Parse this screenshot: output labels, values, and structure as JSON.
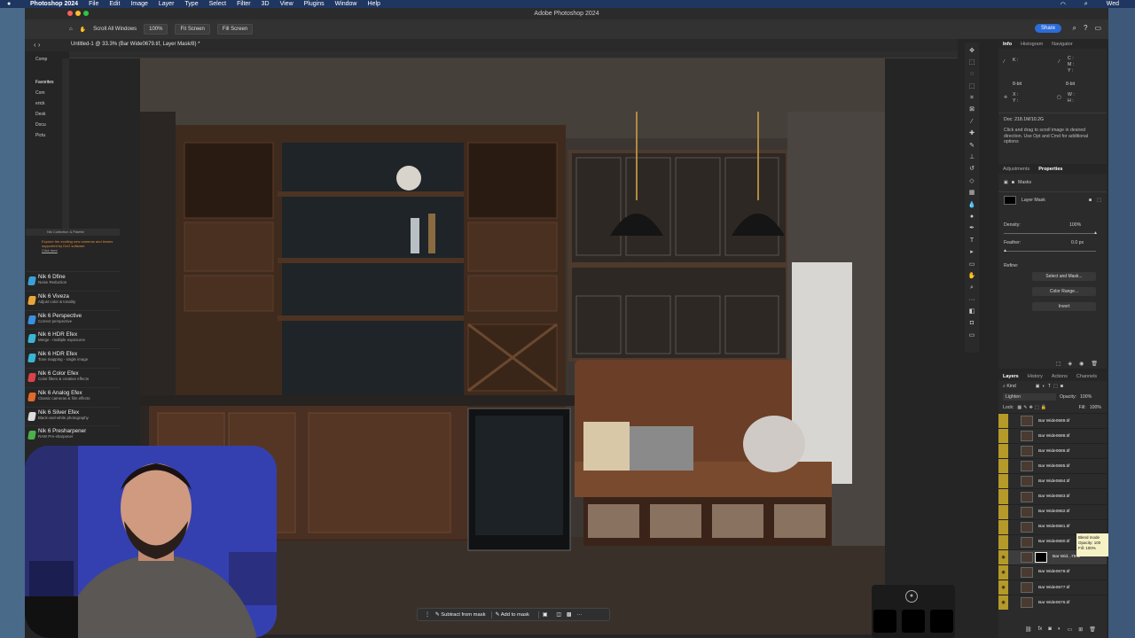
{
  "menubar": {
    "apple": "",
    "app": "Photoshop 2024",
    "items": [
      "File",
      "Edit",
      "Image",
      "Layer",
      "Type",
      "Select",
      "Filter",
      "3D",
      "View",
      "Plugins",
      "Window",
      "Help"
    ],
    "clock": "Wed"
  },
  "window": {
    "title": "Adobe Photoshop 2024"
  },
  "options": {
    "scroll_all": "Scroll All Windows",
    "zoom": "100%",
    "fit_screen": "Fit Screen",
    "fill_screen": "Fill Screen",
    "share": "Share"
  },
  "document": {
    "tab": "Untitled-1 @ 33.3% (Bar Wide0679.tif, Layer Mask/8) *"
  },
  "finder_sidebar": {
    "top_item": "Comp",
    "favorites_label": "Favorites",
    "items": [
      "Com",
      "erick",
      "Desk",
      "Docu",
      "Pictu"
    ]
  },
  "nik": {
    "header": "Nik Collection & Palette",
    "promo": "Explore the exciting new cameras and lenses supported by DxO software",
    "promo_link": "Click here",
    "items": [
      {
        "name": "Nik 6 Dfine",
        "desc": "Noise Reduction",
        "color": "#3aa0d8"
      },
      {
        "name": "Nik 6 Viveza",
        "desc": "Adjust color & tonality",
        "color": "#e8a63a"
      },
      {
        "name": "Nik 6 Perspective",
        "desc": "Correct perspective",
        "color": "#3a8fe0"
      },
      {
        "name": "Nik 6 HDR Efex",
        "desc": "Merge - multiple exposures",
        "color": "#39b4d4"
      },
      {
        "name": "Nik 6 HDR Efex",
        "desc": "Tone mapping - single image",
        "color": "#39b4d4"
      },
      {
        "name": "Nik 6 Color Efex",
        "desc": "Color filters & creative effects",
        "color": "#d8434a"
      },
      {
        "name": "Nik 6 Analog Efex",
        "desc": "Classic cameras & film effects",
        "color": "#e06a2a"
      },
      {
        "name": "Nik 6 Silver Efex",
        "desc": "Black-and-white photography",
        "color": "#dddddd"
      },
      {
        "name": "Nik 6 Presharpener",
        "desc": "RAW Pre-sharpener",
        "color": "#4ab04a"
      }
    ]
  },
  "info_panel": {
    "tabs": [
      "Info",
      "Histogram",
      "Navigator"
    ],
    "bit": "8-bit",
    "doc": "Doc: 218.1M/10.2G",
    "hint": "Click and drag to scroll image in desired direction. Use Opt and Cmd for additional options",
    "labels": {
      "k": "K :",
      "c": "C :",
      "m": "M :",
      "y": "Y :",
      "x": "X :",
      "yy": "Y :",
      "w": "W :",
      "h": "H :"
    }
  },
  "properties": {
    "tabs": [
      "Adjustments",
      "Properties"
    ],
    "section": "Masks",
    "layer_mask": "Layer Mask",
    "density_label": "Density:",
    "density_value": "100%",
    "feather_label": "Feather:",
    "feather_value": "0.0 px",
    "refine_label": "Refine:",
    "select_and_mask": "Select and Mask...",
    "color_range": "Color Range...",
    "invert": "Invert"
  },
  "layers": {
    "tabs": [
      "Layers",
      "History",
      "Actions",
      "Channels"
    ],
    "filter": "Kind",
    "blend": "Lighten",
    "opacity_label": "Opacity:",
    "opacity": "100%",
    "lock_label": "Lock:",
    "fill_label": "Fill:",
    "fill": "100%",
    "items": [
      {
        "name": "Bar Wide0689.tif",
        "visible": false,
        "mask": false
      },
      {
        "name": "Bar Wide0688.tif",
        "visible": false,
        "mask": false
      },
      {
        "name": "Bar Wide0686.tif",
        "visible": false,
        "mask": false
      },
      {
        "name": "Bar Wide0685.tif",
        "visible": false,
        "mask": false
      },
      {
        "name": "Bar Wide0684.tif",
        "visible": false,
        "mask": false
      },
      {
        "name": "Bar Wide0683.tif",
        "visible": false,
        "mask": false
      },
      {
        "name": "Bar Wide0682.tif",
        "visible": false,
        "mask": false
      },
      {
        "name": "Bar Wide0681.tif",
        "visible": false,
        "mask": false
      },
      {
        "name": "Bar Wide0680.tif",
        "visible": false,
        "mask": false
      },
      {
        "name": "Bar Wid...79.tif",
        "visible": true,
        "mask": true
      },
      {
        "name": "Bar Wide0678.tif",
        "visible": true,
        "mask": false
      },
      {
        "name": "Bar Wide0677.tif",
        "visible": true,
        "mask": false
      },
      {
        "name": "Bar Wide0676.tif",
        "visible": true,
        "mask": false
      }
    ]
  },
  "tooltip": {
    "line1": "Blend mode",
    "line2": "Opacity: 100",
    "line3": "Fill: 100%"
  },
  "maskbar": {
    "subtract": "Subtract from mask",
    "add": "Add to mask",
    "more": "···"
  },
  "colors": {
    "accent": "#2c6cd9",
    "layer_color_tag": "#b59a2a",
    "canvas_bg": "#3a352f"
  }
}
